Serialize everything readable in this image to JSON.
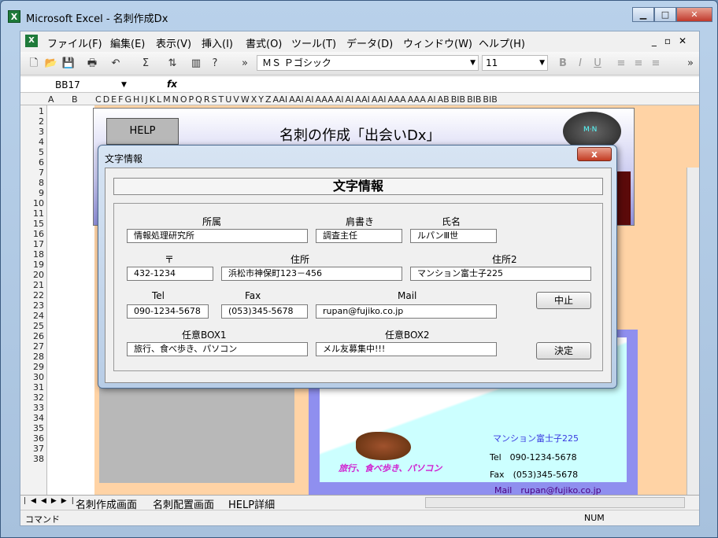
{
  "window": {
    "title": "Microsoft Excel - 名刺作成Dx",
    "icon": "X"
  },
  "menubar": {
    "items": [
      "ファイル(F)",
      "編集(E)",
      "表示(V)",
      "挿入(I)",
      "書式(O)",
      "ツール(T)",
      "データ(D)",
      "ウィンドウ(W)",
      "ヘルプ(H)"
    ]
  },
  "toolbar": {
    "font_name": "ＭＳ Ｐゴシック",
    "font_size": "11"
  },
  "formula_bar": {
    "name_box": "BB17",
    "fx": "fx"
  },
  "grid": {
    "columns": [
      "A",
      "B",
      "C",
      "D",
      "E",
      "F",
      "G",
      "H",
      "I",
      "J",
      "K",
      "L",
      "M",
      "N",
      "O",
      "P",
      "Q",
      "R",
      "S",
      "T",
      "U",
      "V",
      "W",
      "X",
      "Y",
      "Z",
      "AAI",
      "AAI",
      "AI",
      "AAA",
      "AI",
      "AI",
      "AAI",
      "AAI",
      "AAA",
      "AAA",
      "AI",
      "AB",
      "BIB",
      "BIB",
      "BIB"
    ],
    "rows": [
      "1",
      "2",
      "3",
      "4",
      "5",
      "6",
      "7",
      "8",
      "9",
      "10",
      "11",
      "15",
      "16",
      "17",
      "18",
      "19",
      "20",
      "21",
      "22",
      "23",
      "24",
      "25",
      "26",
      "27",
      "28",
      "29",
      "30",
      "31",
      "32",
      "33",
      "34",
      "35",
      "36",
      "37",
      "38"
    ]
  },
  "card": {
    "help": "HELP",
    "title": "名刺の作成「出会いDx」",
    "ashtray_text": "M·N",
    "address2": "マンション富士子225",
    "tel": "Tel　090-1234-5678",
    "fax": "Fax　(053)345-5678",
    "mail": "Mail　rupan@fujiko.co.jp",
    "hobby": "旅行、食べ歩き、パソコン"
  },
  "dialog": {
    "title": "文字情報",
    "close": "x",
    "header": "文字情報",
    "labels": {
      "affiliation": "所属",
      "position": "肩書き",
      "name": "氏名",
      "zip": "〒",
      "address": "住所",
      "address2": "住所2",
      "tel": "Tel",
      "fax": "Fax",
      "mail": "Mail",
      "box1": "任意BOX1",
      "box2": "任意BOX2"
    },
    "values": {
      "affiliation": "情報処理研究所",
      "position": "調査主任",
      "name": "ルパンⅢ世",
      "zip": "432-1234",
      "address": "浜松市神保町123－456",
      "address2": "マンション富士子225",
      "tel": "090-1234-5678",
      "fax": "(053)345-5678",
      "mail": "rupan@fujiko.co.jp",
      "box1": "旅行、食べ歩き、パソコン",
      "box2": "メル友募集中!!!"
    },
    "cancel": "中止",
    "ok": "決定"
  },
  "sheets": [
    "名刺作成画面",
    "名刺配置画面",
    "HELP詳細"
  ],
  "status": {
    "left": "コマンド",
    "num": "NUM"
  }
}
